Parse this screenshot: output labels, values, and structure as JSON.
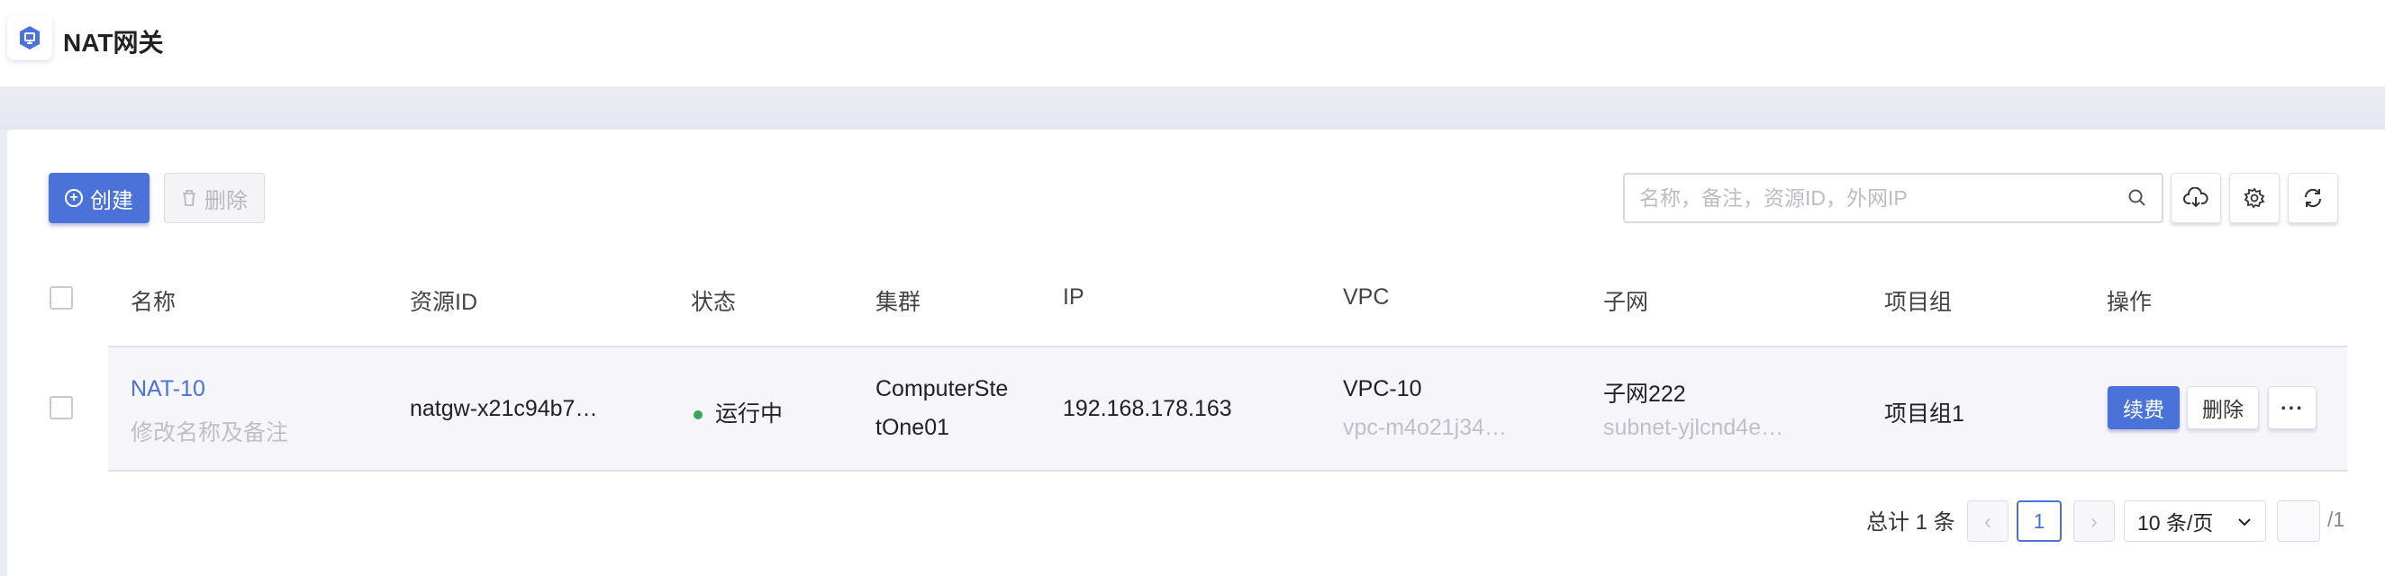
{
  "header": {
    "title": "NAT网关",
    "logo_icon": "nat-gateway-logo-icon"
  },
  "toolbar": {
    "create_label": "创建",
    "delete_label": "删除",
    "search_placeholder": "名称，备注，资源ID，外网IP",
    "search_value": "",
    "icons": [
      "cloud-download-icon",
      "gear-icon",
      "refresh-icon"
    ]
  },
  "table": {
    "columns": [
      "名称",
      "资源ID",
      "状态",
      "集群",
      "IP",
      "VPC",
      "子网",
      "项目组",
      "操作"
    ],
    "rows": [
      {
        "name": "NAT-10",
        "name_sub": "修改名称及备注",
        "resource_id": "natgw-x21c94b7…",
        "status": "运行中",
        "status_color": "#3aa55a",
        "cluster_line1": "ComputerSte",
        "cluster_line2": "tOne01",
        "ip": "192.168.178.163",
        "vpc": "VPC-10",
        "vpc_sub": "vpc-m4o21j34…",
        "subnet": "子网222",
        "subnet_sub": "subnet-yjlcnd4e…",
        "project": "项目组1",
        "actions": {
          "renew": "续费",
          "delete": "删除",
          "more": "···"
        }
      }
    ]
  },
  "pagination": {
    "total": "总计 1 条",
    "prev": "‹",
    "current": "1",
    "next": "›",
    "page_size": "10 条/页",
    "jump_value": "",
    "of_pages": "/1"
  },
  "colors": {
    "accent": "#4a72d8",
    "running": "#3aa55a"
  }
}
